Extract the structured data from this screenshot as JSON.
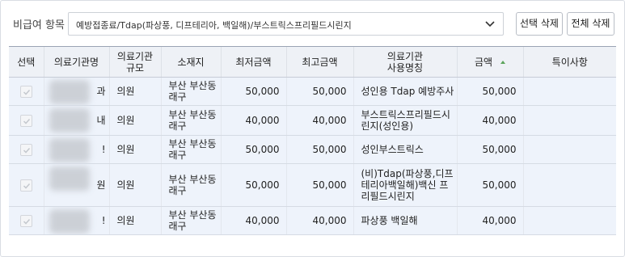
{
  "filter": {
    "label": "비급여 항목",
    "selected": "예방접종료/Tdap(파상풍, 디프테리아, 백일해)/부스트릭스프리필드시린지"
  },
  "buttons": {
    "delete_selected": "선택 삭제",
    "delete_all": "전체 삭제"
  },
  "table": {
    "headers": {
      "select": "선택",
      "org_name": "의료기관명",
      "org_scale": "의료기관\n규모",
      "location": "소재지",
      "min_price": "최저금액",
      "max_price": "최고금액",
      "usage_name": "의료기관\n사용명칭",
      "amount": "금액",
      "notes": "특이사항"
    },
    "rows": [
      {
        "name_suffix": "과",
        "scale": "의원",
        "location": "부산 부산동\n래구",
        "min": "50,000",
        "max": "50,000",
        "usage": "성인용 Tdap 예방주사",
        "amount": "50,000",
        "notes": ""
      },
      {
        "name_suffix": "내",
        "scale": "의원",
        "location": "부산 부산동\n래구",
        "min": "40,000",
        "max": "40,000",
        "usage": "부스트릭스프리필드시\n린지(성인용)",
        "amount": "40,000",
        "notes": ""
      },
      {
        "name_suffix": "!",
        "scale": "의원",
        "location": "부산 부산동\n래구",
        "min": "50,000",
        "max": "50,000",
        "usage": "성인부스트릭스",
        "amount": "50,000",
        "notes": ""
      },
      {
        "name_suffix": "원",
        "scale": "의원",
        "location": "부산 부산동\n래구",
        "min": "50,000",
        "max": "50,000",
        "usage": "(비)Tdap(파상풍,디프\n테리아백일해)백신 프\n리필드시린지",
        "amount": "50,000",
        "notes": ""
      },
      {
        "name_suffix": "!",
        "scale": "의원",
        "location": "부산 부산동\n래구",
        "min": "40,000",
        "max": "40,000",
        "usage": "파상풍 백일해",
        "amount": "40,000",
        "notes": ""
      }
    ]
  },
  "colors": {
    "header_bg": "#eef1f6",
    "row_bg": "#eef3fb",
    "sort_icon": "#5aa35a"
  },
  "icons": {
    "dropdown": "chevron-down-icon",
    "sort": "sort-asc-icon",
    "checkbox": "check-icon"
  }
}
